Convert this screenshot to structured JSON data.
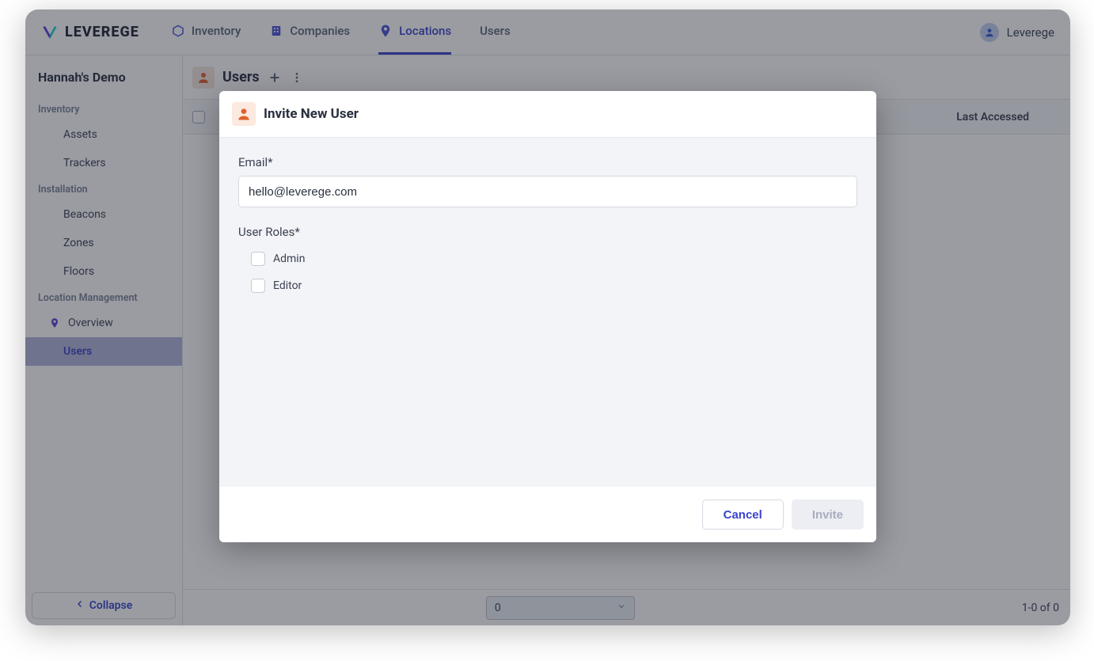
{
  "brand": {
    "name": "LEVEREGE"
  },
  "nav": {
    "tabs": [
      {
        "label": "Inventory",
        "icon": "cube"
      },
      {
        "label": "Companies",
        "icon": "building"
      },
      {
        "label": "Locations",
        "icon": "pin",
        "active": true
      },
      {
        "label": "Users",
        "icon": ""
      }
    ]
  },
  "header_user": {
    "label": "Leverege"
  },
  "sidebar": {
    "title": "Hannah's Demo",
    "sections": [
      {
        "label": "Inventory",
        "items": [
          {
            "label": "Assets"
          },
          {
            "label": "Trackers"
          }
        ]
      },
      {
        "label": "Installation",
        "items": [
          {
            "label": "Beacons"
          },
          {
            "label": "Zones"
          },
          {
            "label": "Floors"
          }
        ]
      },
      {
        "label": "Location Management",
        "items": [
          {
            "label": "Overview",
            "icon": "pin"
          },
          {
            "label": "Users",
            "active": true
          }
        ]
      }
    ],
    "collapse": "Collapse"
  },
  "main": {
    "title": "Users",
    "columns": {
      "last_accessed": "Last Accessed"
    },
    "footer": {
      "page_select": "0",
      "count": "1-0 of 0"
    }
  },
  "modal": {
    "title": "Invite New User",
    "email_label": "Email*",
    "email_value": "hello@leverege.com",
    "roles_label": "User Roles*",
    "roles": [
      {
        "label": "Admin"
      },
      {
        "label": "Editor"
      }
    ],
    "cancel": "Cancel",
    "invite": "Invite"
  }
}
